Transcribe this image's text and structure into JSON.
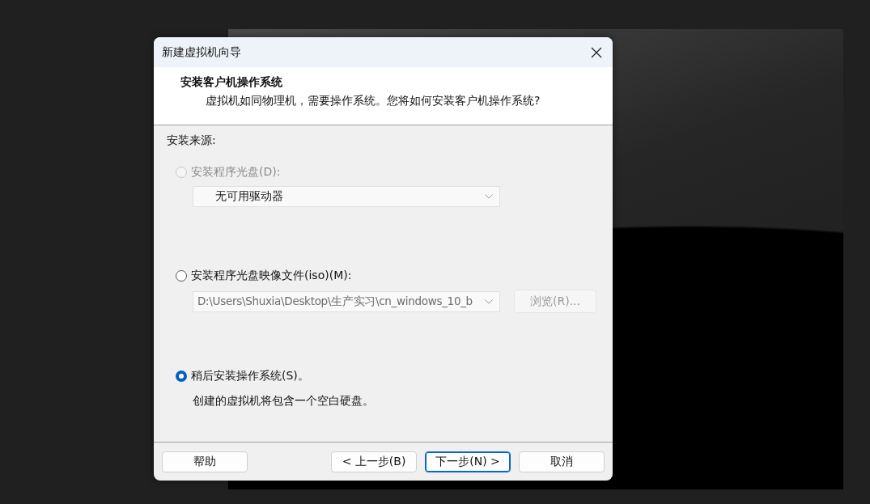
{
  "window": {
    "title": "新建虚拟机向导"
  },
  "header": {
    "title": "安装客户机操作系统",
    "subtitle": "虚拟机如同物理机，需要操作系统。您将如何安装客户机操作系统?"
  },
  "section_label": "安装来源:",
  "options": [
    {
      "kind": "drive",
      "label": "安装程序光盘(D):",
      "selected": false,
      "disabled": true,
      "dropdown": {
        "value": "无可用驱动器",
        "disabled": true
      }
    },
    {
      "kind": "image",
      "label": "安装程序光盘映像文件(iso)(M):",
      "selected": false,
      "disabled": false,
      "dropdown": {
        "value": "D:\\Users\\Shuxia\\Desktop\\生产实习\\cn_windows_10_b",
        "disabled": true
      },
      "browse": {
        "label": "浏览(R)...",
        "disabled": true
      }
    },
    {
      "kind": "later",
      "label": "稍后安装操作系统(S)。",
      "selected": true,
      "disabled": false,
      "note": "创建的虚拟机将包含一个空白硬盘。"
    }
  ],
  "buttons": [
    {
      "label": "帮助",
      "kind": "help",
      "focused": false
    },
    {
      "label": "< 上一步(B)",
      "kind": "nav",
      "focused": false
    },
    {
      "label": "下一步(N) >",
      "kind": "nav",
      "focused": true
    },
    {
      "label": "取消",
      "kind": "nav",
      "focused": false
    }
  ]
}
